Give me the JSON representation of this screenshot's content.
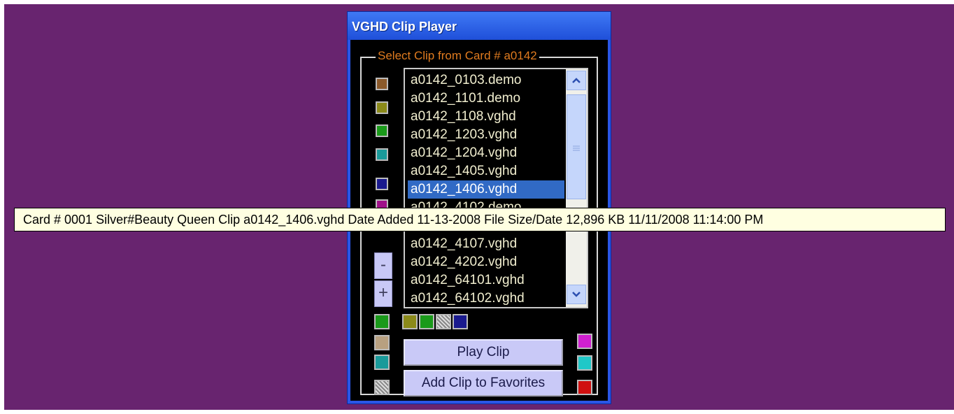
{
  "window": {
    "title": "VGHD Clip Player"
  },
  "group": {
    "label": "Select Clip from Card # a0142"
  },
  "clips": [
    "a0142_0103.demo",
    "a0142_1101.demo",
    "a0142_1108.vghd",
    "a0142_1203.vghd",
    "a0142_1204.vghd",
    "a0142_1405.vghd",
    "a0142_1406.vghd",
    "a0142_4102.demo",
    "a0142_4107.vghd",
    "a0142_4202.vghd",
    "a0142_64101.vghd",
    "a0142_64102.vghd"
  ],
  "selected_clip": "a0142_1406.vghd",
  "scrollbar": {
    "up_icon": "chevron-up-icon",
    "down_icon": "chevron-down-icon",
    "grip_icon": "grip-icon"
  },
  "zoom": {
    "minus_label": "-",
    "plus_label": "+"
  },
  "buttons": {
    "play_label": "Play Clip",
    "favorites_label": "Add Clip to Favorites"
  },
  "tooltip": {
    "text": "Card # 0001 Silver#Beauty Queen   Clip a0142_1406.vghd   Date Added 11-13-2008   File Size/Date 12,896 KB 11/11/2008 11:14:00 PM"
  },
  "colors": {
    "desktop": "#68246f",
    "title_bar": "#2a56e6",
    "group_label": "#e07b1f",
    "list_text": "#f1eecf",
    "selection": "#316ac5",
    "swatch_left": [
      "#8b5a2b",
      "#8b8a1a",
      "#1a9a1a",
      "#1a9a9a",
      "#1a1a8e",
      "#a0108a"
    ],
    "swatch_bottom_row": [
      "#8b8a1a",
      "#1a9a1a",
      "#a0c8c8",
      "#1a1a8e"
    ],
    "swatch_bottom_left": [
      "#1a9a1a",
      "#b8a080",
      "#1a9a9a",
      "#909090"
    ],
    "swatch_right": [
      "#d020d0",
      "#20c8c8",
      "#d01010"
    ]
  }
}
